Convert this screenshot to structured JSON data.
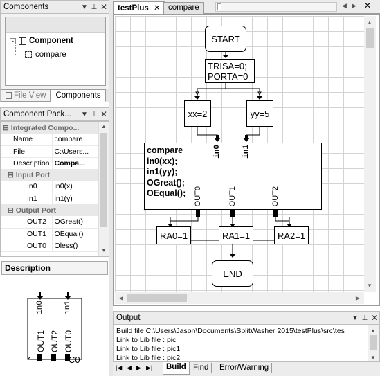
{
  "components_panel": {
    "title": "Components",
    "tree": {
      "root": "Component",
      "child": "compare"
    },
    "tabs": [
      "File View",
      "Components"
    ]
  },
  "package_panel": {
    "title": "Component Pack...",
    "categories": {
      "integrated": "Integrated Compo...",
      "input": "Input Port",
      "output": "Output Port"
    },
    "integrated_rows": [
      {
        "name": "Name",
        "value": "compare"
      },
      {
        "name": "File",
        "value": "C:\\Users..."
      },
      {
        "name": "Description",
        "value": "Compa..."
      }
    ],
    "input_rows": [
      {
        "name": "In0",
        "value": "in0(x)"
      },
      {
        "name": "In1",
        "value": "in1(y)"
      }
    ],
    "output_rows": [
      {
        "name": "OUT2",
        "value": "OGreat()"
      },
      {
        "name": "OUT1",
        "value": "OEqual()"
      },
      {
        "name": "OUT0",
        "value": "Oless()"
      }
    ]
  },
  "description_panel": {
    "title": "Description",
    "preview": {
      "in0": "in0",
      "in1": "in1",
      "out1": "OUT1",
      "out2": "OUT2",
      "out0": "OUT0",
      "c0": "C0"
    }
  },
  "editor": {
    "tabs": [
      "testPlus",
      "compare"
    ],
    "flowchart": {
      "start": "START",
      "init": [
        "TRISA=0;",
        "PORTA=0"
      ],
      "xx": "xx=2",
      "yy": "yy=5",
      "compare_lines": [
        "compare",
        "in0(xx);",
        "in1(yy);",
        "OGreat();",
        "OEqual();"
      ],
      "in0": "in0",
      "in1": "in1",
      "out0": "OUT0",
      "out1": "OUT1",
      "out2": "OUT2",
      "ra0": "RA0=1",
      "ra1": "RA1=1",
      "ra2": "RA2=1",
      "end": "END"
    }
  },
  "output_panel": {
    "title": "Output",
    "lines": [
      "Build file  C:\\Users\\Jason\\Documents\\SplitWasher 2015\\testPlus\\src\\tes",
      "Link to Lib file : pic",
      "Link to Lib file : pic1",
      "Link to Lib file : pic2"
    ],
    "tabs": [
      "Build",
      "Find",
      "Error/Warning"
    ]
  },
  "icons": {
    "pin": "pin-icon",
    "close": "close-icon",
    "dropdown": "dropdown-arrow-icon"
  }
}
